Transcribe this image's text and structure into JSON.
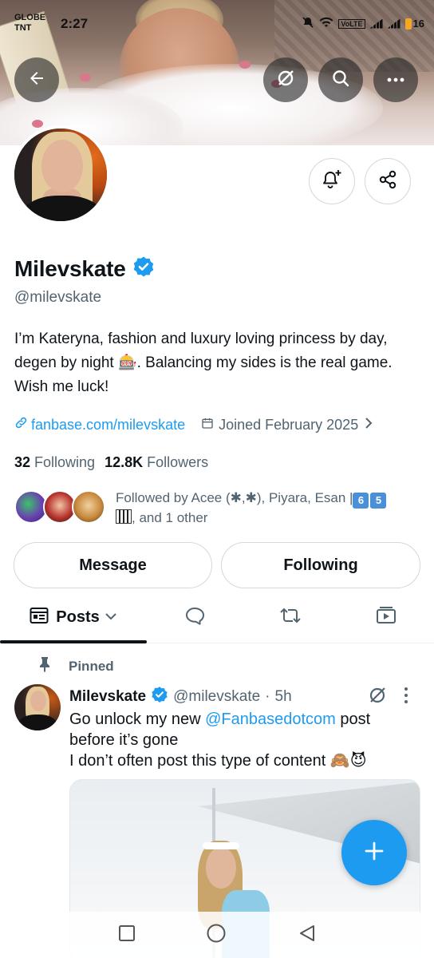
{
  "status_bar": {
    "carrier_line1": "GLOBE",
    "carrier_line2": "TNT",
    "time": "2:27",
    "network": "VoLTE",
    "battery": "16"
  },
  "header_actions": {
    "back_icon": "arrow-left-icon",
    "grok_icon": "slash-circle-icon",
    "search_icon": "search-icon",
    "more_icon": "more-horizontal-icon"
  },
  "profile": {
    "display_name": "Milevskate",
    "verified": true,
    "handle": "@milevskate",
    "bio_line1": "I’m Kateryna,  fashion and luxury loving princess by day,",
    "bio_line2": "degen by night 🎰. Balancing my sides is the real game.",
    "bio_line3": "Wish me luck!",
    "website": "fanbase.com/milevskate",
    "joined": "Joined February 2025",
    "following_count": "32",
    "following_label": "Following",
    "followers_count": "12.8K",
    "followers_label": "Followers",
    "followed_by_prefix": "Followed by Acee (✱,✱), Piyara, Esan |",
    "followed_by_k1": "6",
    "followed_by_k2": "5",
    "followed_by_suffix": ", and 1 other"
  },
  "buttons": {
    "message": "Message",
    "following": "Following"
  },
  "tabs": {
    "posts": "Posts"
  },
  "post": {
    "pinned_label": "Pinned",
    "author_name": "Milevskate",
    "author_handle": "@milevskate",
    "separator": "·",
    "time": "5h",
    "text_line1_prefix": "Go unlock my new ",
    "text_mention": "@Fanbasedotcom",
    "text_line1_suffix": " post",
    "text_line2": "before it’s gone",
    "text_line3": "I don’t often post this type of content 🙈😈"
  },
  "colors": {
    "accent": "#1d9bf0",
    "secondary_text": "#536471",
    "primary_text": "#0f1419",
    "border": "#cfd9de"
  }
}
